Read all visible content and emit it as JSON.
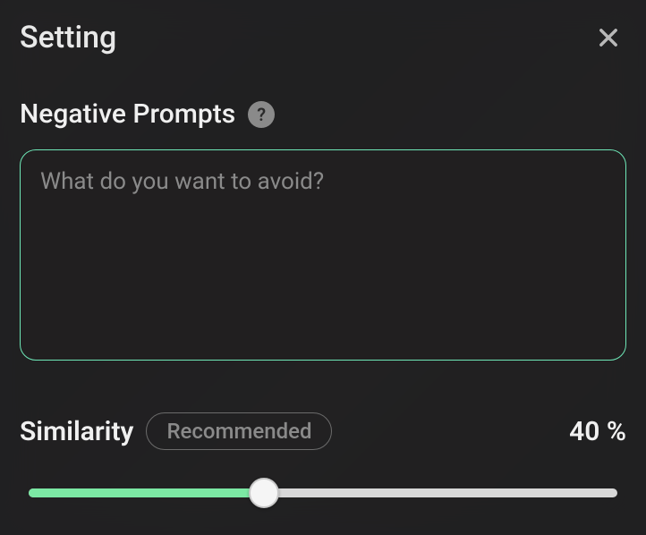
{
  "panel": {
    "title": "Setting"
  },
  "negative_prompts": {
    "label": "Negative Prompts",
    "placeholder": "What do you want to avoid?",
    "value": ""
  },
  "similarity": {
    "label": "Similarity",
    "badge": "Recommended",
    "value_display": "40 %",
    "percent": 40
  },
  "icons": {
    "help": "?",
    "close": "close-icon"
  }
}
